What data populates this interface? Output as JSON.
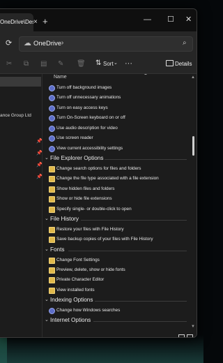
{
  "window": {
    "tab_title": "OneDrive\\Desk",
    "tab_close": "×",
    "new_tab": "+",
    "minimize": "—",
    "maximize": "☐",
    "close": "✕"
  },
  "address": {
    "refresh_icon": "⟳",
    "location": "OneDrive",
    "separator": "›",
    "search_icon": "⌕"
  },
  "toolbar": {
    "sort_label": "Sort",
    "more_label": "···",
    "details_label": "Details"
  },
  "nav": {
    "partial_item": "ance Group Ltd"
  },
  "list": {
    "column_header": "Name",
    "groups": [
      {
        "title": "",
        "items": [
          "Turn off background images",
          "Turn off unnecessary animations",
          "Turn on easy access keys",
          "Turn On-Screen keyboard on or off",
          "Use audio description for video",
          "Use screen reader",
          "View current accessibility settings"
        ]
      },
      {
        "title": "File Explorer Options",
        "items": [
          "Change search options for files and folders",
          "Change the file type associated with a file extension",
          "Show hidden files and folders",
          "Show or hide file extensions",
          "Specify single- or double-click to open"
        ]
      },
      {
        "title": "File History",
        "items": [
          "Restore your files with File History",
          "Save backup copies of your files with File History"
        ]
      },
      {
        "title": "Fonts",
        "items": [
          "Change Font Settings",
          "Preview, delete, show or hide fonts",
          "Private Character Editor",
          "View installed fonts"
        ]
      },
      {
        "title": "Indexing Options",
        "items": [
          "Change how Windows searches"
        ]
      },
      {
        "title": "Internet Options",
        "items": []
      }
    ]
  },
  "colors": {
    "accent_icon": "#5d6ec8",
    "folder_icon": "#e0b94c",
    "window_bg": "#1c1c1c"
  }
}
